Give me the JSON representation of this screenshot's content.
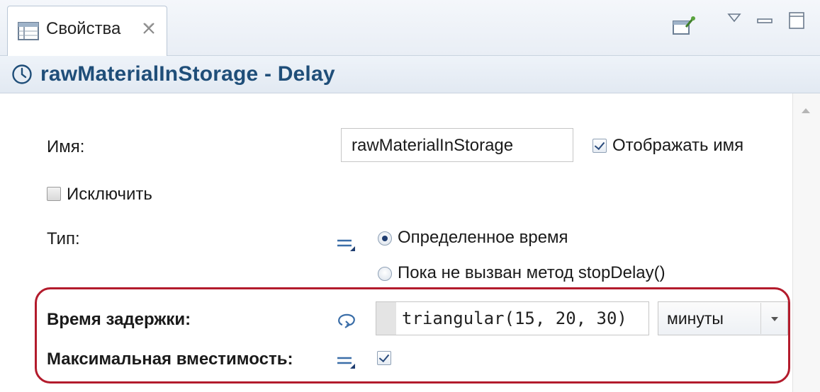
{
  "tab": {
    "label": "Свойства",
    "icon": "properties-table-icon",
    "close_icon": "close-icon"
  },
  "toolbar": {
    "icons": [
      "pin-to-view-icon",
      "view-menu-icon",
      "minimize-icon",
      "maximize-icon"
    ]
  },
  "header": {
    "icon": "clock-icon",
    "title": "rawMaterialInStorage - Delay"
  },
  "form": {
    "name": {
      "label": "Имя:",
      "value": "rawMaterialInStorage",
      "show_name_label": "Отображать имя",
      "show_name_checked": true
    },
    "exclude": {
      "label": "Исключить",
      "checked": false
    },
    "type": {
      "label": "Тип:",
      "options": [
        "Определенное время",
        "Пока не вызван метод stopDelay()"
      ],
      "selected": "Определенное время"
    },
    "delay_time": {
      "label": "Время задержки:",
      "expression": "triangular(15, 20, 30)",
      "units": "минуты"
    },
    "max_capacity": {
      "label": "Максимальная вместимость:",
      "checked": true
    }
  },
  "colors": {
    "header_title": "#1f4e79",
    "highlight_border": "#b31b2c"
  }
}
